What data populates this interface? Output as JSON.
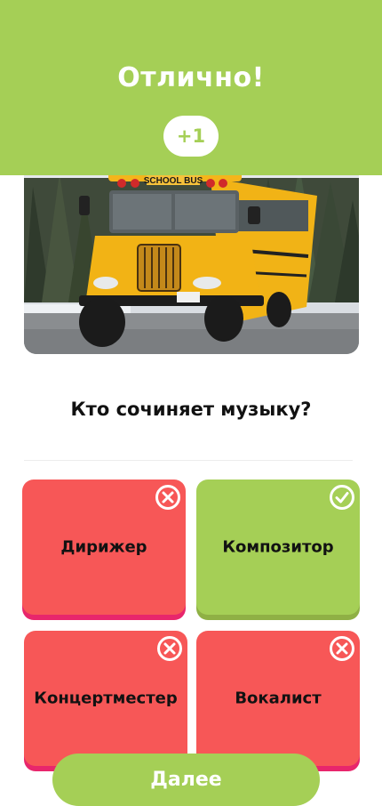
{
  "banner": {
    "title": "Отлично!",
    "points": "+1",
    "color": "#a5cf56"
  },
  "question": {
    "text": "Кто сочиняет музыку?"
  },
  "answers": [
    {
      "label": "Дирижер",
      "status": "wrong",
      "icon": "close-circle-icon"
    },
    {
      "label": "Композитор",
      "status": "correct",
      "icon": "check-circle-icon"
    },
    {
      "label": "Концертместер",
      "status": "wrong",
      "icon": "close-circle-icon"
    },
    {
      "label": "Вокалист",
      "status": "wrong",
      "icon": "close-circle-icon"
    }
  ],
  "image": {
    "bus_sign": "SCHOOL BUS"
  },
  "next_button": {
    "label": "Далее"
  },
  "colors": {
    "correct": "#a5cf56",
    "wrong": "#f75757",
    "wrong_shadow": "#e8266c"
  }
}
